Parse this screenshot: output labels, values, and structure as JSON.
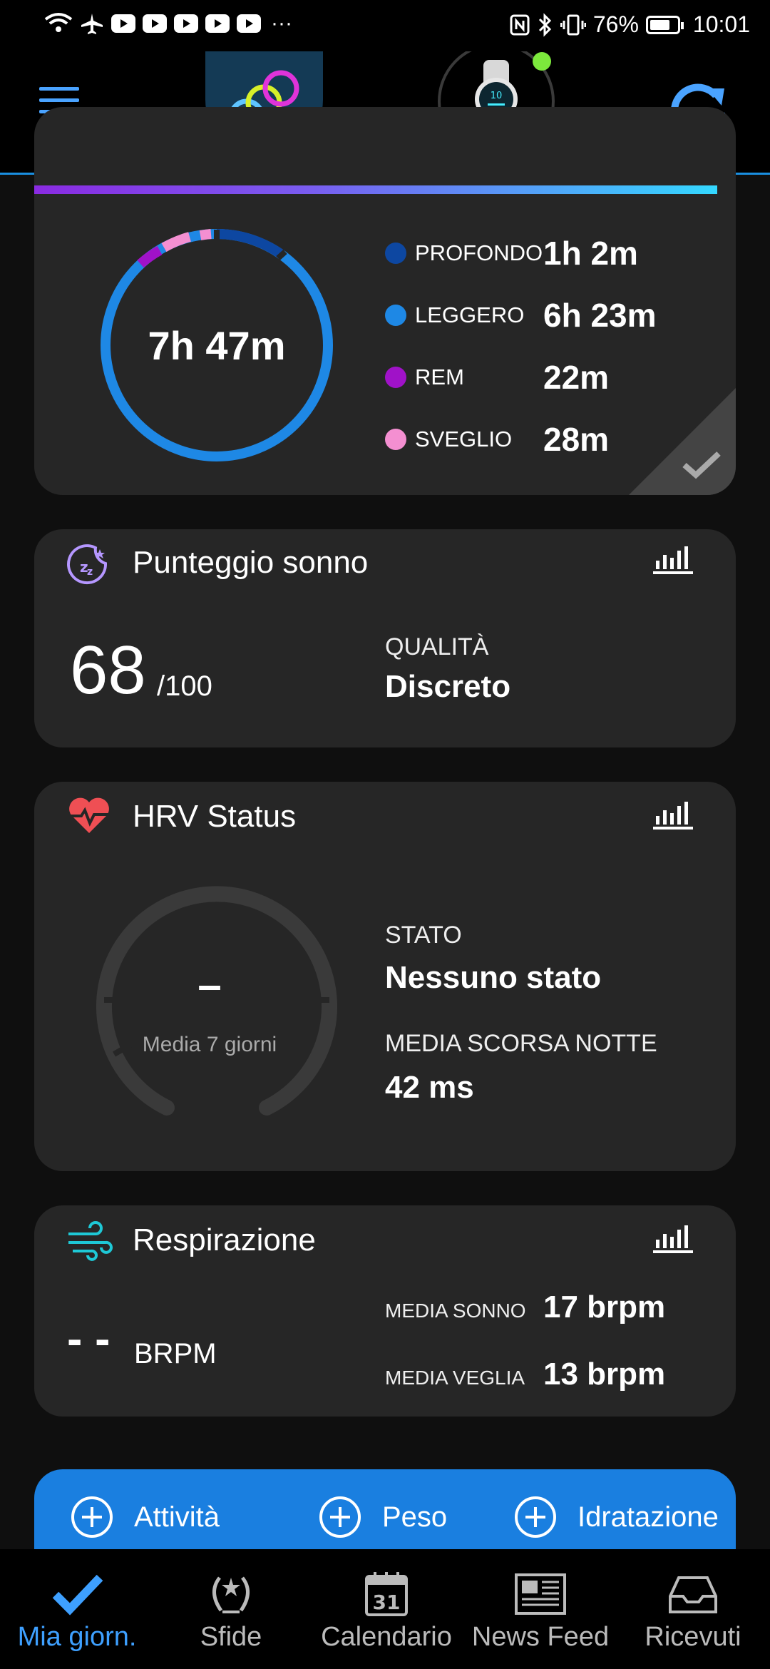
{
  "status_bar": {
    "battery": "76%",
    "time": "10:01",
    "battery_level": 0.76
  },
  "sleep": {
    "total": "7h 47m",
    "stages": [
      {
        "label": "PROFONDO",
        "value": "1h 2m",
        "color": "#0d47a1"
      },
      {
        "label": "LEGGERO",
        "value": "6h 23m",
        "color": "#1e88e5"
      },
      {
        "label": "REM",
        "value": "22m",
        "color": "#a012c8"
      },
      {
        "label": "SVEGLIO",
        "value": "28m",
        "color": "#f48fd1"
      }
    ]
  },
  "sleep_score": {
    "title": "Punteggio sonno",
    "score": "68",
    "max": "/100",
    "quality_label": "QUALITÀ",
    "quality_value": "Discreto"
  },
  "hrv": {
    "title": "HRV Status",
    "value": "–",
    "avg_label": "Media 7 giorni",
    "state_label": "STATO",
    "state_value": "Nessuno stato",
    "last_night_label": "MEDIA SCORSA NOTTE",
    "last_night_value": "42 ms"
  },
  "respiration": {
    "title": "Respirazione",
    "value": "- -",
    "unit": "BRPM",
    "sleep_avg_label": "MEDIA SONNO",
    "sleep_avg_value": "17 brpm",
    "wake_avg_label": "MEDIA VEGLIA",
    "wake_avg_value": "13 brpm"
  },
  "quick_add": [
    {
      "label": "Attività"
    },
    {
      "label": "Peso"
    },
    {
      "label": "Idratazione"
    }
  ],
  "nav": [
    {
      "label": "Mia giorn.",
      "active": true
    },
    {
      "label": "Sfide"
    },
    {
      "label": "Calendario"
    },
    {
      "label": "News Feed"
    },
    {
      "label": "Ricevuti"
    }
  ],
  "colors": {
    "accent": "#1e88e5",
    "nav_active": "#3ea0ff",
    "quick_bar": "#1a7fe0"
  },
  "calendar_day": "31"
}
